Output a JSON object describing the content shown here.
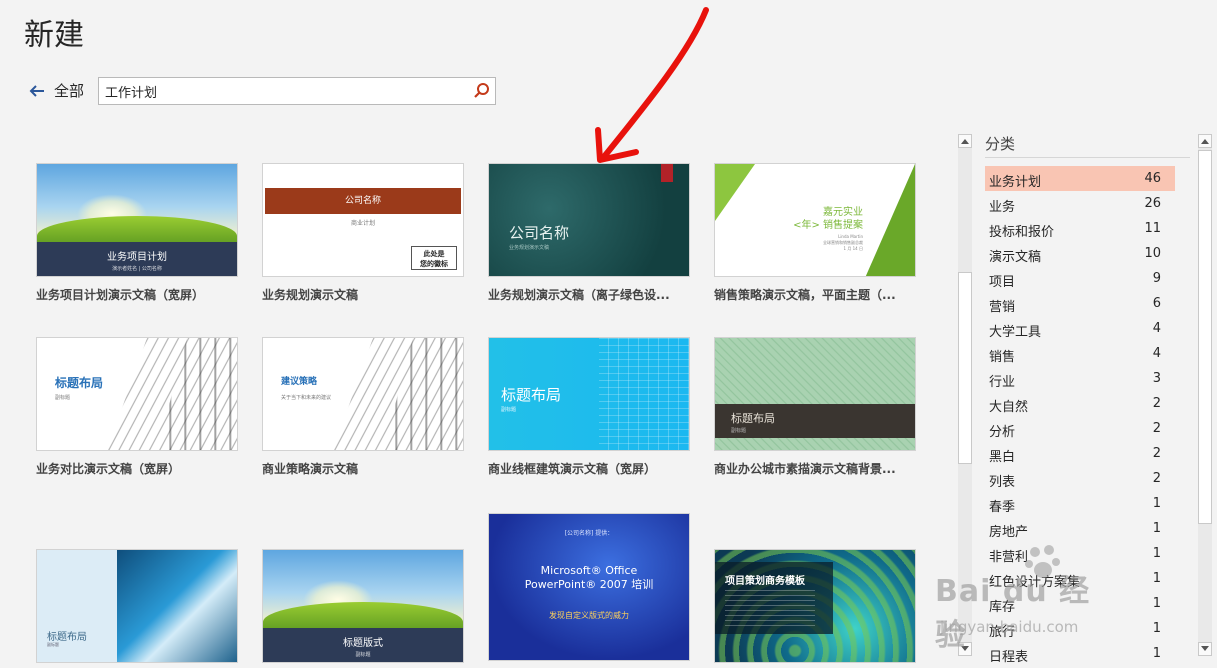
{
  "page": {
    "title": "新建"
  },
  "nav": {
    "back_label": "全部"
  },
  "search": {
    "value": "工作计划"
  },
  "templates": [
    {
      "caption": "业务项目计划演示文稿（宽屏）",
      "thumb_title": "业务项目计划",
      "thumb_sub": "演示者姓名 | 公司名称"
    },
    {
      "caption": "业务规划演示文稿",
      "thumb_title": "公司名称",
      "thumb_sub": "商业计划",
      "thumb_logo": "此处是\n您的徽标"
    },
    {
      "caption": "业务规划演示文稿（离子绿色设...",
      "thumb_title": "公司名称",
      "thumb_sub": "业务规划演示文稿"
    },
    {
      "caption": "销售策略演示文稿，平面主题（...",
      "thumb_title": "嘉元实业\n<年> 销售提案",
      "thumb_sub": "Linda Martin\n全球营销和销售副总裁\n1 月 14 日"
    },
    {
      "caption": "业务对比演示文稿（宽屏）",
      "thumb_title": "标题布局",
      "thumb_sub": "副标题"
    },
    {
      "caption": "商业策略演示文稿",
      "thumb_title": "建议策略",
      "thumb_sub": "关于当下和未来的建议"
    },
    {
      "caption": "商业线框建筑演示文稿（宽屏）",
      "thumb_title": "标题布局",
      "thumb_sub": "副标题"
    },
    {
      "caption": "商业办公城市素描演示文稿背景...",
      "thumb_title": "标题布局",
      "thumb_sub": "副标题"
    },
    {
      "caption": "",
      "thumb_title": "标题布局",
      "thumb_sub": "副标题"
    },
    {
      "caption": "",
      "thumb_title": "标题版式",
      "thumb_sub": "副标题"
    },
    {
      "caption": "",
      "thumb_title": "Microsoft® Office\nPowerPoint® 2007 培训",
      "thumb_pre": "[公司名称] 提供：",
      "thumb_sub": "发现自定义版式的威力"
    },
    {
      "caption": "",
      "thumb_title": "项目策划商务模板"
    }
  ],
  "categories": {
    "heading": "分类",
    "items": [
      {
        "label": "业务计划",
        "count": "46",
        "selected": true
      },
      {
        "label": "业务",
        "count": "26"
      },
      {
        "label": "投标和报价",
        "count": "11"
      },
      {
        "label": "演示文稿",
        "count": "10"
      },
      {
        "label": "项目",
        "count": "9"
      },
      {
        "label": "营销",
        "count": "6"
      },
      {
        "label": "大学工具",
        "count": "4"
      },
      {
        "label": "销售",
        "count": "4"
      },
      {
        "label": "行业",
        "count": "3"
      },
      {
        "label": "大自然",
        "count": "2"
      },
      {
        "label": "分析",
        "count": "2"
      },
      {
        "label": "黑白",
        "count": "2"
      },
      {
        "label": "列表",
        "count": "2"
      },
      {
        "label": "春季",
        "count": "1"
      },
      {
        "label": "房地产",
        "count": "1"
      },
      {
        "label": "非营利",
        "count": "1"
      },
      {
        "label": "红色设计方案集",
        "count": "1"
      },
      {
        "label": "库存",
        "count": "1"
      },
      {
        "label": "旅行",
        "count": "1"
      },
      {
        "label": "日程表",
        "count": "1"
      }
    ]
  },
  "watermark": {
    "text": "Bai du 经验",
    "url": "jingyan.baidu.com"
  },
  "colors": {
    "selected_category": "#f9c5b3",
    "annotation_arrow": "#e8120c",
    "accent_blue": "#2a72b8"
  }
}
